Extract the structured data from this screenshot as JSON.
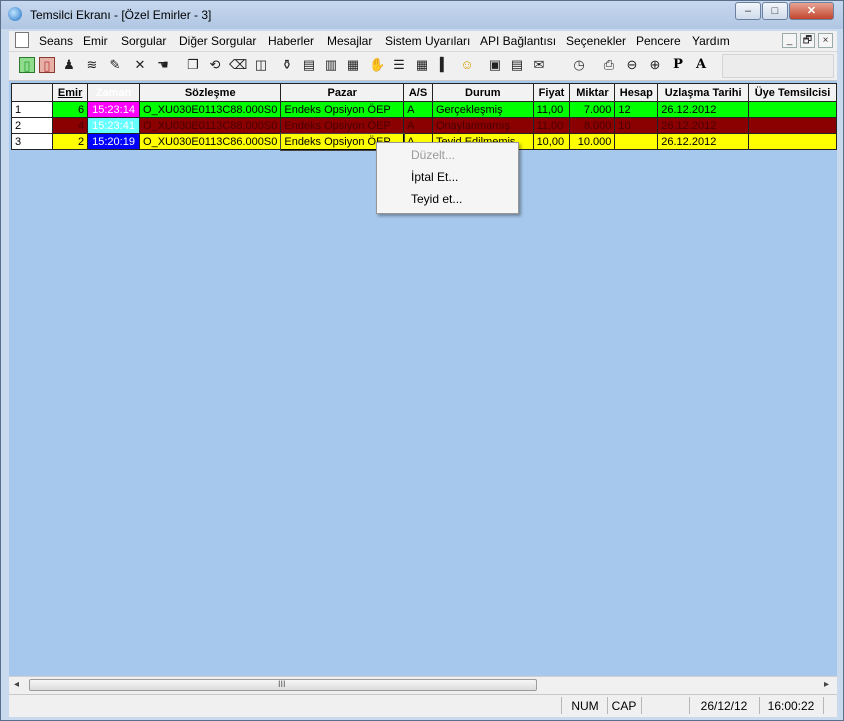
{
  "window": {
    "title": "Temsilci Ekranı - [Özel Emirler - 3]",
    "buttons": {
      "minimize": "–",
      "maximize": "□",
      "close": "✕"
    }
  },
  "menu": {
    "items": [
      "Seans",
      "Emir",
      "Sorgular",
      "Diğer Sorgular",
      "Haberler",
      "Mesajlar",
      "Sistem Uyarıları",
      "API Bağlantısı",
      "Seçenekler",
      "Pencere",
      "Yardım"
    ],
    "mdi": {
      "minimize": "_",
      "restore": "🗗",
      "close": "×"
    }
  },
  "toolbar": {
    "icons": [
      "new-green-icon",
      "new-red-icon",
      "chess-pawn-icon",
      "stack-icon",
      "edit-note-icon",
      "cross-icon",
      "hand-icon",
      "window-copy-icon",
      "loop-icon",
      "eraser-icon",
      "panel-icon",
      "bottle-icon",
      "page-icon",
      "document-icon",
      "papers-icon",
      "hand-stop-icon",
      "list-lines-icon",
      "columns-icon",
      "bar-chart-icon",
      "smiley-icon",
      "book-icon",
      "book-open-icon",
      "inbox-icon",
      "clock-icon",
      "printer-icon",
      "zoom-out-icon",
      "zoom-in-icon",
      "p-letter-icon",
      "a-letter-icon"
    ],
    "glyphs": [
      "▯",
      "▯",
      "♟",
      "≋",
      "✎",
      "✕",
      "☚",
      "❐",
      "⟲",
      "⌫",
      "◫",
      "⚱",
      "▤",
      "▥",
      "▦",
      "✋",
      "☰",
      "▦",
      "▍",
      "☺",
      "▣",
      "▤",
      "✉",
      "◷",
      "⎙",
      "⊖",
      "⊕",
      "P",
      "A"
    ],
    "p_label": "P",
    "a_label": "A"
  },
  "grid": {
    "columns": [
      "",
      "Emir",
      "Zaman",
      "Sözleşme",
      "Pazar",
      "A/S",
      "Durum",
      "Fiyat",
      "Miktar",
      "Hesap",
      "Uzlaşma Tarihi",
      "Üye Temsilcisi"
    ],
    "rows": [
      {
        "no": "1",
        "emir": "6",
        "zaman": "15:23:14",
        "sozlesme": "O_XU030E0113C88.000S0",
        "pazar": "Endeks Opsiyon ÖEP",
        "as": "A",
        "durum": "Gerçekleşmiş",
        "fiyat": "11,00",
        "miktar": "7.000",
        "hesap": "12",
        "uzlasma": "26.12.2012",
        "uye": "",
        "color": "green",
        "zaman_color": "magenta"
      },
      {
        "no": "2",
        "emir": "4",
        "zaman": "15:23:41",
        "sozlesme": "O_XU030E0113C88.000S0",
        "pazar": "Endeks Opsiyon ÖEP",
        "as": "A",
        "durum": "Onaylanmamış",
        "fiyat": "11,00",
        "miktar": "8.000",
        "hesap": "10",
        "uzlasma": "26.12.2012",
        "uye": "",
        "color": "maroon",
        "zaman_color": "cyan"
      },
      {
        "no": "3",
        "emir": "2",
        "zaman": "15:20:19",
        "sozlesme": "O_XU030E0113C86.000S0",
        "pazar": "Endeks Opsiyon ÖEP",
        "as": "A",
        "durum": "Teyid Edilmemiş",
        "fiyat": "10,00",
        "miktar": "10.000",
        "hesap": "",
        "uzlasma": "26.12.2012",
        "uye": "",
        "color": "yellow",
        "zaman_color": "blue"
      }
    ]
  },
  "context_menu": {
    "items": [
      {
        "label": "Düzelt...",
        "enabled": false
      },
      {
        "label": "İptal Et...",
        "enabled": true
      },
      {
        "label": "Teyid et...",
        "enabled": true
      }
    ]
  },
  "scrollbar": {
    "left_arrow": "◂",
    "right_arrow": "▸",
    "grip": "III"
  },
  "statusbar": {
    "num": "NUM",
    "cap": "CAP",
    "date": "26/12/12",
    "time": "16:00:22"
  },
  "colors": {
    "content_bg": "#a6c8ec",
    "green": "#00ff00",
    "maroon": "#8b0000",
    "yellow": "#ffff00",
    "magenta": "#ff00ff",
    "cyan": "#66ffff",
    "blue": "#0000ff"
  }
}
